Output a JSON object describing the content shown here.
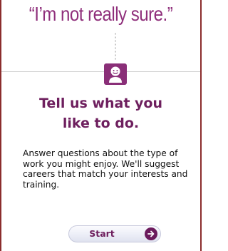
{
  "quote": "“I’m not really sure.”",
  "heading": {
    "line1": "Tell us what you",
    "line2": "like to do."
  },
  "description": "Answer questions about the type of work you might enjoy. We'll suggest careers that match your interests and training.",
  "start_button": {
    "label": "Start",
    "icon": "arrow-right-circle-icon"
  },
  "person_icon": "smiling-person-icon",
  "colors": {
    "accent": "#8f2f7b",
    "heading": "#6e1f5e",
    "frame": "#8b2d2d"
  }
}
